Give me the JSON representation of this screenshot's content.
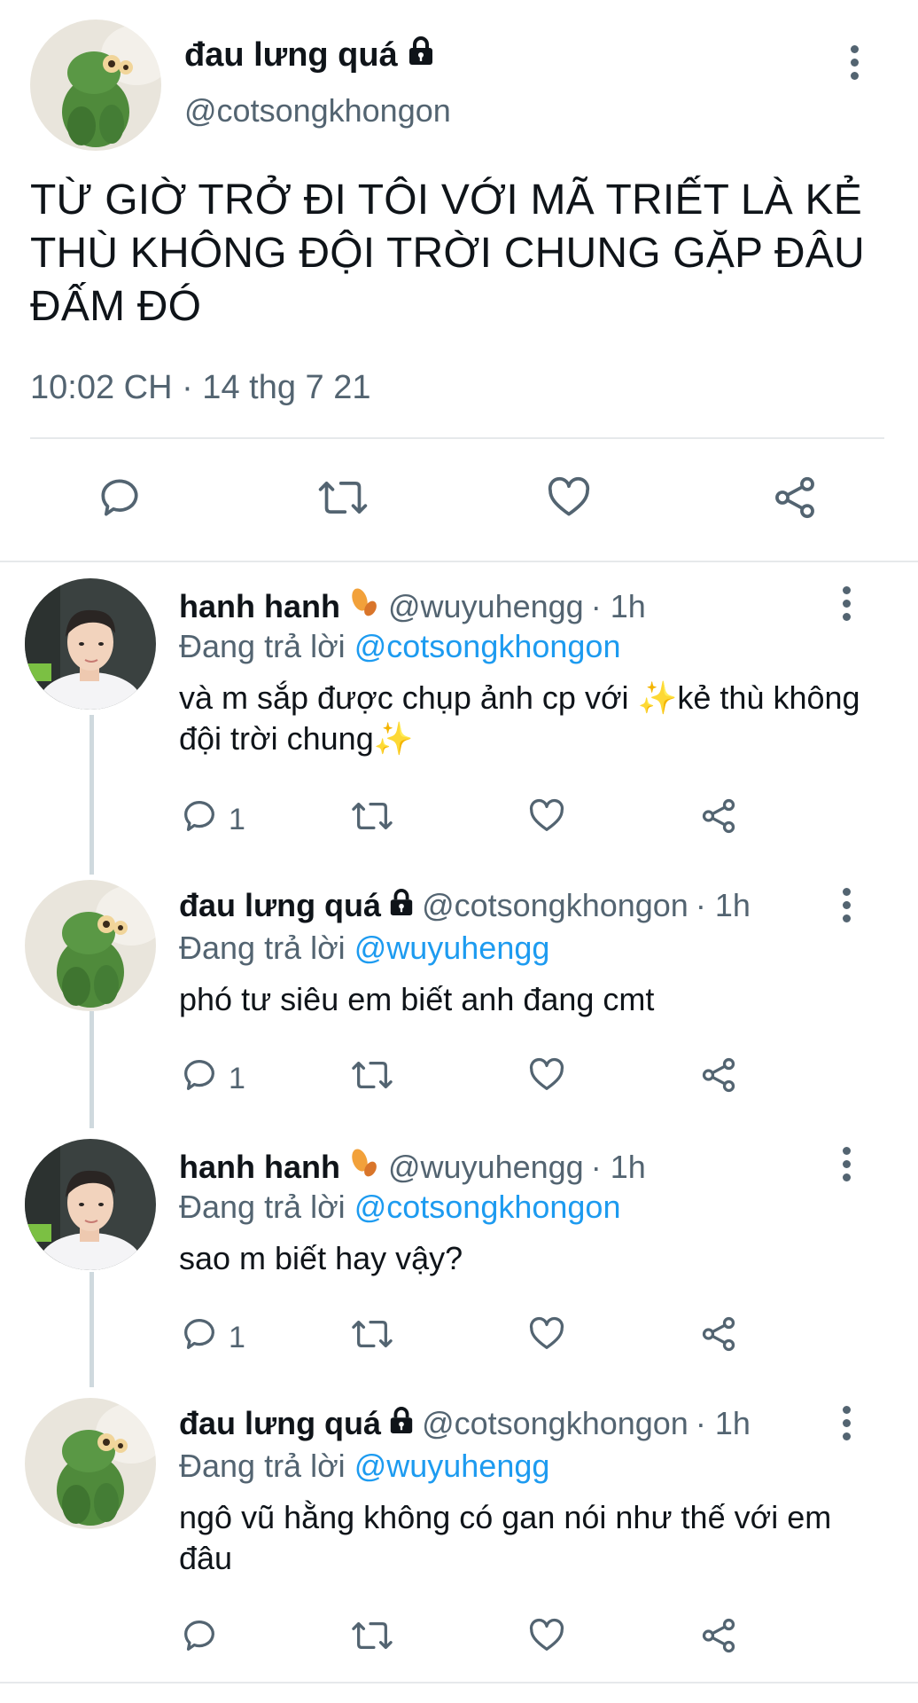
{
  "main_tweet": {
    "author_name": "đau lưng quá",
    "author_handle": "@cotsongkhongon",
    "text": "TỪ GIỜ TRỞ ĐI TÔI VỚI MÃ TRIẾT LÀ KẺ THÙ KHÔNG ĐỘI TRỜI CHUNG GẶP ĐÂU ĐẤM ĐÓ",
    "timestamp": "10:02 CH · 14 thg 7 21",
    "actions": [
      "reply-icon",
      "retweet-icon",
      "like-icon",
      "share-icon"
    ]
  },
  "replies": [
    {
      "author_name": "hanh hanh",
      "author_handle": "@wuyuhengg",
      "time": "· 1h",
      "replying_label": "Đang trả lời",
      "replying_to": "@cotsongkhongon",
      "text_parts": [
        "và m sắp được chụp ảnh cp với ",
        "✨",
        "kẻ thù không đội trời chung",
        "✨"
      ],
      "reply_count": "1",
      "avatar": "boy"
    },
    {
      "author_name": "đau lưng quá",
      "author_handle": "@cotsongkhongon",
      "time": "· 1h",
      "replying_label": "Đang trả lời",
      "replying_to": "@wuyuhengg",
      "text_parts": [
        "phó tư siêu em biết anh đang cmt"
      ],
      "reply_count": "1",
      "avatar": "frog"
    },
    {
      "author_name": "hanh hanh",
      "author_handle": "@wuyuhengg",
      "time": "· 1h",
      "replying_label": "Đang trả lời",
      "replying_to": "@cotsongkhongon",
      "text_parts": [
        "sao m biết hay vậy?"
      ],
      "reply_count": "1",
      "avatar": "boy"
    },
    {
      "author_name": "đau lưng quá",
      "author_handle": "@cotsongkhongon",
      "time": "· 1h",
      "replying_label": "Đang trả lời",
      "replying_to": "@wuyuhengg",
      "text_parts": [
        "ngô vũ hằng không có gan nói như thế với em đâu"
      ],
      "reply_count": "",
      "avatar": "frog"
    }
  ],
  "colors": {
    "text": "#0f1419",
    "muted": "#536471",
    "link": "#1d9bf0",
    "divider": "#e6e9eb",
    "thread_line": "#cfd9de"
  }
}
